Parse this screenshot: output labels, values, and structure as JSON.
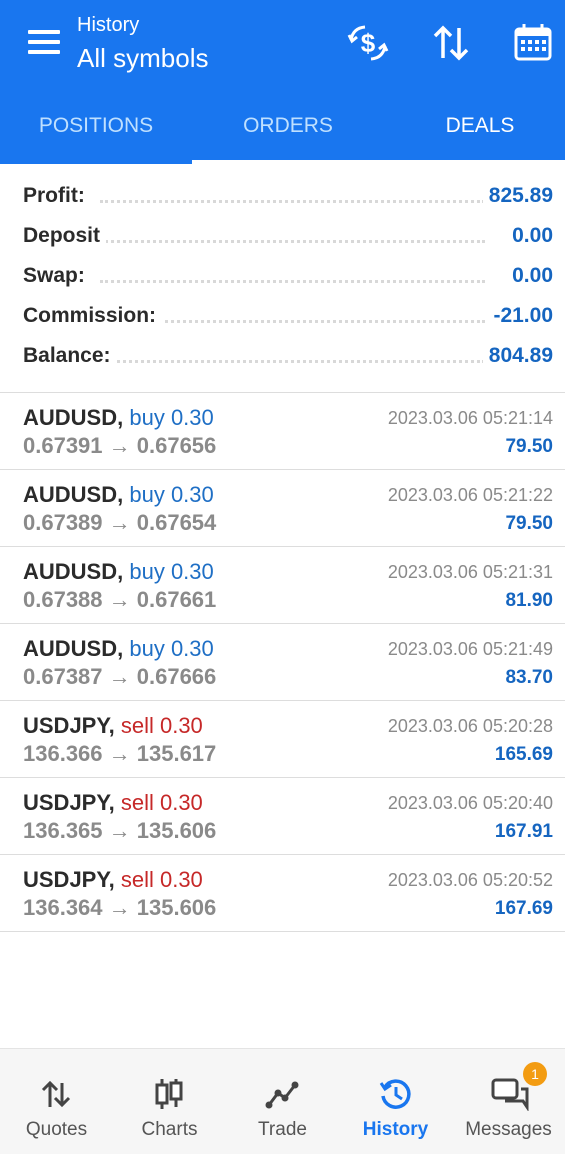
{
  "header": {
    "subtitle": "History",
    "title": "All symbols",
    "icons": [
      "menu-icon",
      "currency-exchange-icon",
      "sort-icon",
      "calendar-icon"
    ]
  },
  "tabs": [
    {
      "label": "POSITIONS",
      "active": false
    },
    {
      "label": "ORDERS",
      "active": false
    },
    {
      "label": "DEALS",
      "active": true
    }
  ],
  "summary": [
    {
      "label": "Profit:",
      "value": "825.89"
    },
    {
      "label": "Deposit",
      "value": "0.00"
    },
    {
      "label": "Swap:",
      "value": "0.00"
    },
    {
      "label": "Commission:",
      "value": "-21.00"
    },
    {
      "label": "Balance:",
      "value": "804.89"
    }
  ],
  "deals": [
    {
      "symbol": "AUDUSD,",
      "side": "buy 0.30",
      "type": "buy",
      "prices": "0.67391 → 0.67656",
      "time": "2023.03.06 05:21:14",
      "profit": "79.50"
    },
    {
      "symbol": "AUDUSD,",
      "side": "buy 0.30",
      "type": "buy",
      "prices": "0.67389 → 0.67654",
      "time": "2023.03.06 05:21:22",
      "profit": "79.50"
    },
    {
      "symbol": "AUDUSD,",
      "side": "buy 0.30",
      "type": "buy",
      "prices": "0.67388 → 0.67661",
      "time": "2023.03.06 05:21:31",
      "profit": "81.90"
    },
    {
      "symbol": "AUDUSD,",
      "side": "buy 0.30",
      "type": "buy",
      "prices": "0.67387 → 0.67666",
      "time": "2023.03.06 05:21:49",
      "profit": "83.70"
    },
    {
      "symbol": "USDJPY,",
      "side": "sell 0.30",
      "type": "sell",
      "prices": "136.366 → 135.617",
      "time": "2023.03.06 05:20:28",
      "profit": "165.69"
    },
    {
      "symbol": "USDJPY,",
      "side": "sell 0.30",
      "type": "sell",
      "prices": "136.365 → 135.606",
      "time": "2023.03.06 05:20:40",
      "profit": "167.91"
    },
    {
      "symbol": "USDJPY,",
      "side": "sell 0.30",
      "type": "sell",
      "prices": "136.364 → 135.606",
      "time": "2023.03.06 05:20:52",
      "profit": "167.69"
    }
  ],
  "bottom_nav": [
    {
      "label": "Quotes",
      "icon": "quotes-icon",
      "active": false
    },
    {
      "label": "Charts",
      "icon": "charts-icon",
      "active": false
    },
    {
      "label": "Trade",
      "icon": "trade-icon",
      "active": false
    },
    {
      "label": "History",
      "icon": "history-icon",
      "active": true
    },
    {
      "label": "Messages",
      "icon": "messages-icon",
      "active": false,
      "badge": "1"
    }
  ],
  "colors": {
    "header_bg": "#1976ef",
    "value_blue": "#1565c0",
    "buy": "#1f6fc5",
    "sell": "#c62828",
    "badge": "#f39c12"
  }
}
